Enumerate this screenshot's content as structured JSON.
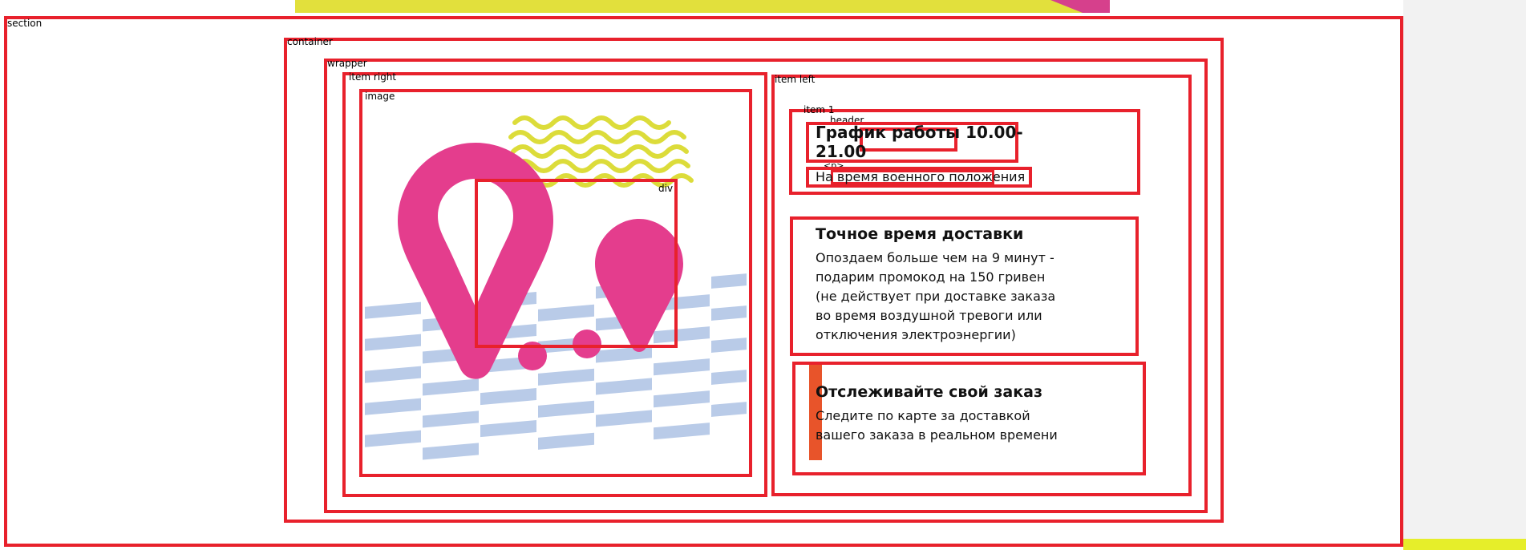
{
  "labels": {
    "section": "section",
    "container": "container",
    "wrapper": "wrapper",
    "item_right": "item right",
    "image": "image",
    "div": "div",
    "item_left": "item left",
    "item_1": "item 1",
    "header": "header",
    "p": "<p>"
  },
  "schedule": {
    "title_line1": "График работы 10.00-",
    "title_line2": "21.00",
    "subtitle": "На время военного положения"
  },
  "delivery": {
    "title": "Точное время доставки",
    "lines": [
      "Опоздаем больше чем на 9 минут -",
      "подарим промокод на 150 гривен",
      "(не действует при доставке заказа",
      "во время воздушной тревоги или",
      "отключения электроэнергии)"
    ]
  },
  "tracking": {
    "title": "Отслеживайте свой заказ",
    "lines": [
      "Следите по карте за доставкой",
      "вашего заказа в реальном времени"
    ]
  },
  "colors": {
    "outline": "#e8212c",
    "pin": "#e43d8d",
    "wave": "#dcdc3a",
    "stripes": "#b9cbe8",
    "orange_bar": "#e8542a",
    "top_banner_yellow": "#e2e03c",
    "top_banner_pink": "#d6408c"
  }
}
